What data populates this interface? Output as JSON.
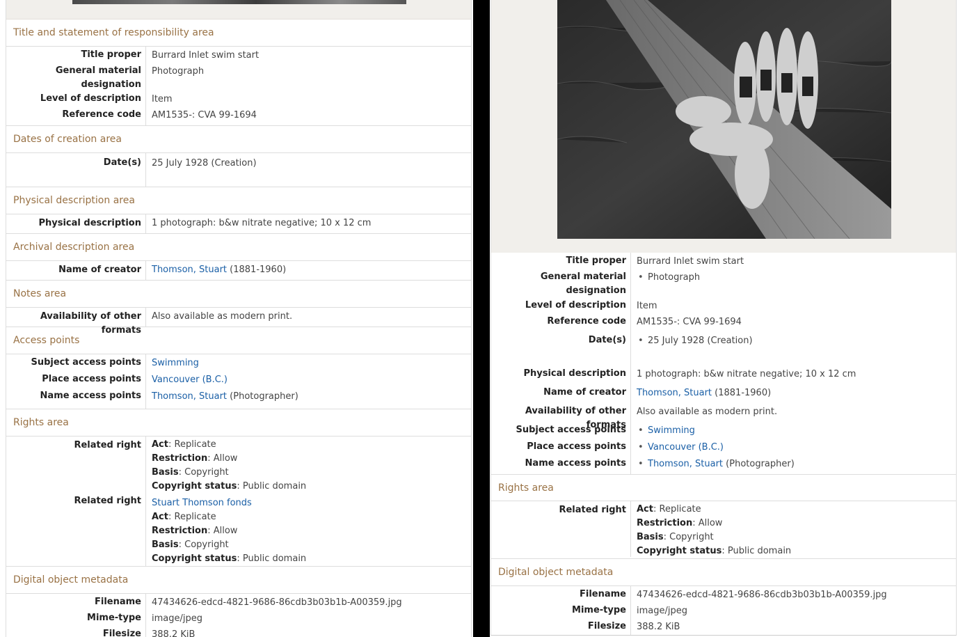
{
  "left": {
    "sections": {
      "title_area": "Title and statement of responsibility area",
      "dates_area": "Dates of creation area",
      "physical_area": "Physical description area",
      "archival_area": "Archival description area",
      "notes_area": "Notes area",
      "access_area": "Access points",
      "rights_area": "Rights area",
      "digital_area": "Digital object metadata"
    },
    "labels": {
      "title_proper": "Title proper",
      "gmd": "General material designation",
      "level": "Level of description",
      "refcode": "Reference code",
      "dates": "Date(s)",
      "physdesc": "Physical description",
      "creator": "Name of creator",
      "formats": "Availability of other formats",
      "subject": "Subject access points",
      "place": "Place access points",
      "name": "Name access points",
      "related_right": "Related right",
      "filename": "Filename",
      "mime": "Mime-type",
      "filesize": "Filesize"
    },
    "values": {
      "title_proper": "Burrard Inlet swim start",
      "gmd": "Photograph",
      "level": "Item",
      "refcode": "AM1535-: CVA 99-1694",
      "dates": "25 July 1928 (Creation)",
      "physdesc": "1 photograph: b&w nitrate negative; 10 x 12 cm",
      "creator_link": "Thomson, Stuart",
      "creator_dates": " (1881-1960)",
      "formats": "Also available as modern print.",
      "subject": "Swimming",
      "place": "Vancouver (B.C.)",
      "name_link": "Thomson, Stuart",
      "name_role": " (Photographer)",
      "right1": {
        "act_k": "Act",
        "act_v": ": Replicate",
        "restriction_k": "Restriction",
        "restriction_v": ": Allow",
        "basis_k": "Basis",
        "basis_v": ": Copyright",
        "status_k": "Copyright status",
        "status_v": ": Public domain"
      },
      "right2": {
        "fonds": "Stuart Thomson fonds",
        "act_k": "Act",
        "act_v": ": Replicate",
        "restriction_k": "Restriction",
        "restriction_v": ": Allow",
        "basis_k": "Basis",
        "basis_v": ": Copyright",
        "status_k": "Copyright status",
        "status_v": ": Public domain"
      },
      "filename": "47434626-edcd-4821-9686-86cdb3b03b1b-A00359.jpg",
      "mime": "image/jpeg",
      "filesize": "388.2 KiB"
    }
  },
  "right": {
    "labels": {
      "title_proper": "Title proper",
      "gmd": "General material designation",
      "level": "Level of description",
      "refcode": "Reference code",
      "dates": "Date(s)",
      "physdesc": "Physical description",
      "creator": "Name of creator",
      "formats": "Availability of other formats",
      "subject": "Subject access points",
      "place": "Place access points",
      "name": "Name access points",
      "rights_area": "Rights area",
      "related_right": "Related right",
      "digital_area": "Digital object metadata",
      "filename": "Filename",
      "mime": "Mime-type",
      "filesize": "Filesize"
    },
    "values": {
      "title_proper": "Burrard Inlet swim start",
      "gmd": "Photograph",
      "level": "Item",
      "refcode": "AM1535-: CVA 99-1694",
      "dates": "25 July 1928 (Creation)",
      "physdesc": "1 photograph: b&w nitrate negative; 10 x 12 cm",
      "creator_link": "Thomson, Stuart",
      "creator_dates": " (1881-1960)",
      "formats": "Also available as modern print.",
      "subject": "Swimming",
      "place": "Vancouver (B.C.)",
      "name_link": "Thomson, Stuart",
      "name_role": " (Photographer)",
      "right1": {
        "act_k": "Act",
        "act_v": ": Replicate",
        "restriction_k": "Restriction",
        "restriction_v": ": Allow",
        "basis_k": "Basis",
        "basis_v": ": Copyright",
        "status_k": "Copyright status",
        "status_v": ": Public domain"
      },
      "filename": "47434626-edcd-4821-9686-86cdb3b03b1b-A00359.jpg",
      "mime": "image/jpeg",
      "filesize": "388.2 KiB"
    }
  },
  "colors": {
    "section_heading": "#997245",
    "link": "#1a5fa6",
    "panel_band": "#f1efeb"
  }
}
